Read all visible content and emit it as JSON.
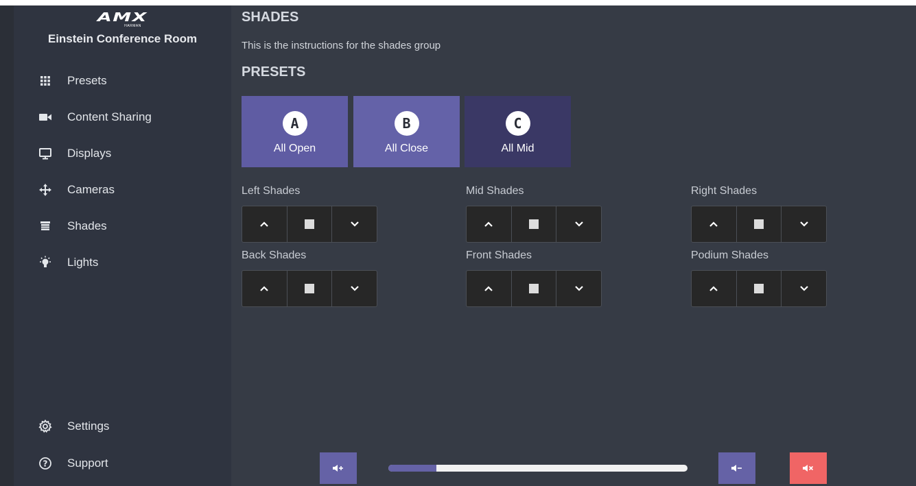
{
  "brand": {
    "logo": "AMX",
    "logo_sub": "HARMAN",
    "room_name": "Einstein Conference Room"
  },
  "sidebar": {
    "items": [
      {
        "label": "Presets",
        "icon": "grid-icon"
      },
      {
        "label": "Content Sharing",
        "icon": "video-icon"
      },
      {
        "label": "Displays",
        "icon": "monitor-icon"
      },
      {
        "label": "Cameras",
        "icon": "move-icon"
      },
      {
        "label": "Shades",
        "icon": "shades-icon"
      },
      {
        "label": "Lights",
        "icon": "bulb-icon"
      }
    ],
    "bottom_items": [
      {
        "label": "Settings",
        "icon": "gear-icon"
      },
      {
        "label": "Support",
        "icon": "help-icon"
      }
    ]
  },
  "main": {
    "title": "SHADES",
    "instructions": "This is the instructions for the shades group",
    "presets_title": "PRESETS",
    "presets": [
      {
        "badge": "A",
        "label": "All Open",
        "color": "#5f5ca3"
      },
      {
        "badge": "B",
        "label": "All Close",
        "color": "#6462a8"
      },
      {
        "badge": "C",
        "label": "All Mid",
        "color": "#3a3865"
      }
    ],
    "shade_groups": [
      {
        "label": "Left Shades"
      },
      {
        "label": "Mid Shades"
      },
      {
        "label": "Right Shades"
      },
      {
        "label": "Back Shades"
      },
      {
        "label": "Front Shades"
      },
      {
        "label": "Podium Shades"
      }
    ]
  },
  "volume": {
    "level": 0.16,
    "colors": {
      "accent": "#6562a6",
      "mute": "#f06565"
    }
  }
}
